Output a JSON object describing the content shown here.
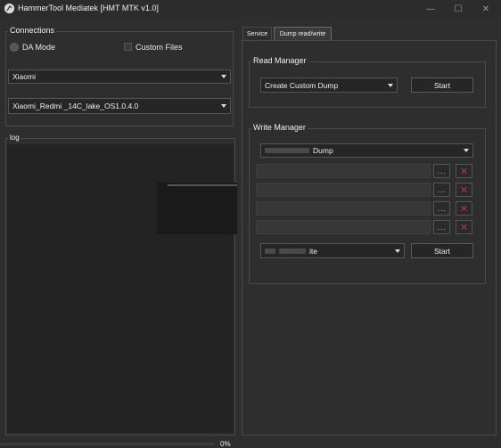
{
  "window": {
    "title": "HammerTool Mediatek [HMT MTK v1.0]",
    "controls": {
      "minimize": "—",
      "maximize": "☐",
      "close": "✕"
    }
  },
  "connections": {
    "title": "Connections",
    "da_mode_label": "DA Mode",
    "custom_files_label": "Custom Files",
    "brand_value": "Xiaomi",
    "firmware_value": "Xiaomi_Redmi _14C_lake_OS1.0.4.0"
  },
  "log": {
    "title": "log"
  },
  "tabs": [
    {
      "label": "Service",
      "active": false
    },
    {
      "label": "Dump read/write",
      "active": true
    }
  ],
  "read_manager": {
    "title": "Read Manager",
    "mode_value": "Create Custom Dump",
    "start_label": "Start"
  },
  "write_manager": {
    "title": "Write Manager",
    "dump_value": "Dump",
    "browse_label": "...",
    "remove_label": "✕",
    "write_mode_value": "ite",
    "start_label": "Start"
  },
  "status": {
    "progress_text": "0%",
    "progress": 0
  },
  "colors": {
    "background": "#2e2e2e",
    "remove_icon": "#b13a3a",
    "active_tab": "#3a3a3a"
  }
}
